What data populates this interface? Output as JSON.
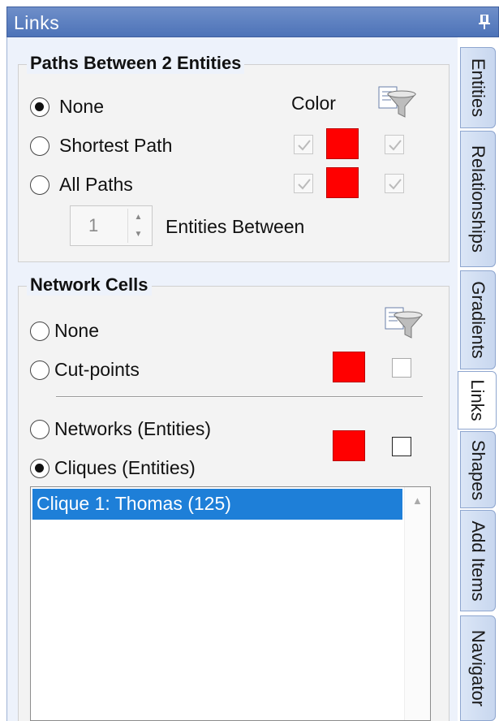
{
  "window": {
    "title": "Links"
  },
  "paths_group": {
    "title": "Paths Between 2 Entities",
    "color_header": "Color",
    "options": [
      {
        "label": "None",
        "checked": true
      },
      {
        "label": "Shortest Path",
        "checked": false
      },
      {
        "label": "All Paths",
        "checked": false
      }
    ],
    "shortest_color": "#ff0000",
    "all_color": "#ff0000",
    "spinner_value": "1",
    "spinner_label": "Entities Between"
  },
  "network_group": {
    "title": "Network Cells",
    "options": [
      {
        "label": "None",
        "checked": false
      },
      {
        "label": "Cut-points",
        "checked": false
      },
      {
        "label": "Networks (Entities)",
        "checked": false
      },
      {
        "label": "Cliques (Entities)",
        "checked": true
      }
    ],
    "cutpoints_color": "#ff0000",
    "networks_color": "#ff0000"
  },
  "list": {
    "items": [
      "Clique 1: Thomas (125)"
    ]
  },
  "tabs": [
    "Entities",
    "Relationships",
    "Gradients",
    "Links",
    "Shapes",
    "Add Items",
    "Navigator"
  ],
  "active_tab": "Links",
  "icons": {
    "pin": "pin-icon",
    "filter": "filter-funnel-icon",
    "check": "check-icon",
    "spin_up": "spin-up-icon",
    "spin_down": "spin-down-icon",
    "scroll_up": "scroll-up-icon"
  }
}
